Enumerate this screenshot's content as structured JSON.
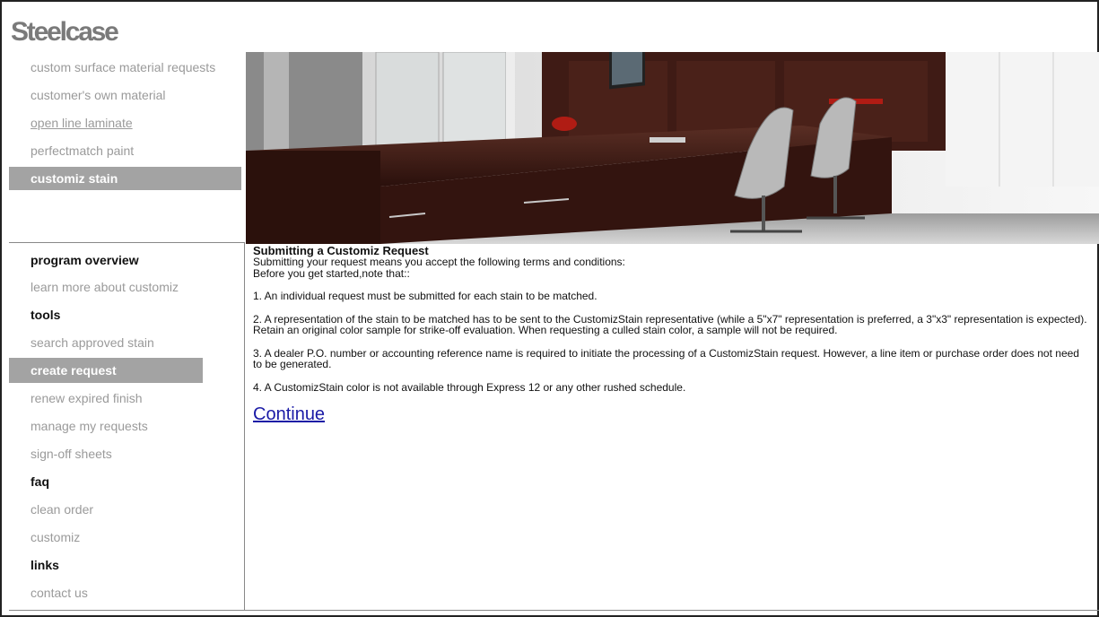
{
  "brand": {
    "logo_text": "Steelcase"
  },
  "top_nav": [
    {
      "label": "custom surface material requests"
    },
    {
      "label": "customer's own material"
    },
    {
      "label": "open line laminate"
    },
    {
      "label": "perfectmatch paint"
    },
    {
      "label": "customiz stain"
    }
  ],
  "side_nav": [
    {
      "label": "program overview"
    },
    {
      "label": "learn more about customiz"
    },
    {
      "label": "tools"
    },
    {
      "label": "search approved stain"
    },
    {
      "label": "create request"
    },
    {
      "label": "renew expired finish"
    },
    {
      "label": "manage my requests"
    },
    {
      "label": "sign-off sheets"
    },
    {
      "label": "faq"
    },
    {
      "label": "clean order"
    },
    {
      "label": "customiz"
    },
    {
      "label": "links"
    },
    {
      "label": "contact us"
    }
  ],
  "content": {
    "title": "Submitting a Customiz Request",
    "intro1": "Submitting your request means you accept the following terms and conditions:",
    "intro2": "Before you get started,note that::",
    "item1": "1. An individual request must be submitted for each stain to be matched.",
    "item2": "2. A representation of the stain to be matched has to be sent to the CustomizStain representative (while a 5\"x7\" representation is preferred, a 3\"x3\" representation is expected). Retain an original color sample for strike-off evaluation. When requesting a culled stain color, a sample will not be required.",
    "item3": "3. A dealer P.O. number or accounting reference name is required to initiate the processing of a CustomizStain request. However, a line item or purchase order does not need to be generated.",
    "item4": "4. A CustomizStain color is not available through Express 12 or any other rushed schedule.",
    "continue_label": "Continue"
  },
  "colors": {
    "active_bg": "#a3a3a3",
    "muted_text": "#9a9a9a",
    "link": "#1a1aa6",
    "desk_wood": "#3a1a14"
  }
}
